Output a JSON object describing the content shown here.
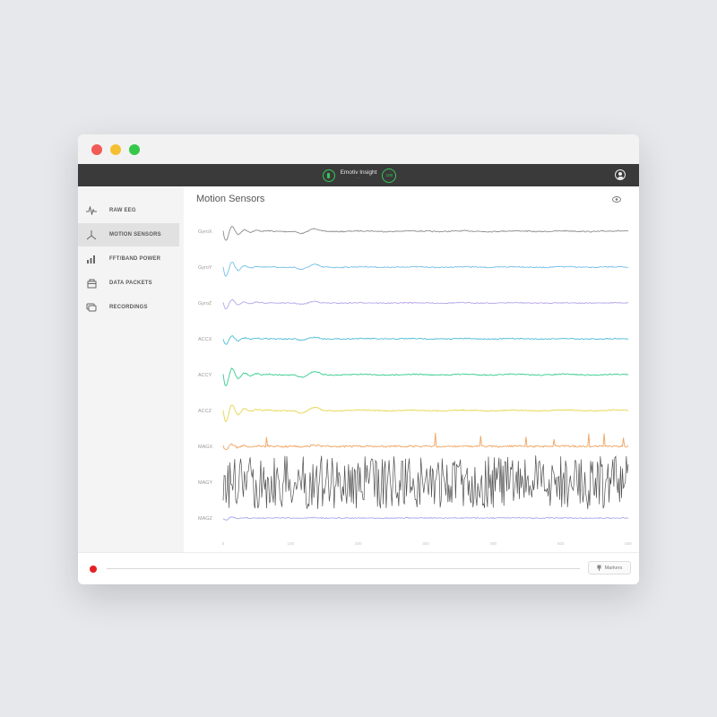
{
  "window": {
    "device": {
      "name": "Emotiv Insight",
      "subtitle": "····",
      "signal_text": "100"
    }
  },
  "sidebar": {
    "items": [
      {
        "label": "RAW EEG",
        "icon": "pulse-icon",
        "active": false
      },
      {
        "label": "MOTION SENSORS",
        "icon": "axes-icon",
        "active": true
      },
      {
        "label": "FFT/BAND POWER",
        "icon": "bars-icon",
        "active": false
      },
      {
        "label": "DATA PACKETS",
        "icon": "package-icon",
        "active": false
      },
      {
        "label": "RECORDINGS",
        "icon": "recordings-icon",
        "active": false
      }
    ]
  },
  "main": {
    "title": "Motion Sensors"
  },
  "footer": {
    "markers_label": "Markers"
  },
  "colors": {
    "accent_green": "#32c85a",
    "record_red": "#e52222",
    "channel_colors": [
      "#8c8c8c",
      "#74bfe6",
      "#b6a5e8",
      "#4dbcd4",
      "#35cc8c",
      "#e6d54a",
      "#f0a35e",
      "#505050",
      "#a8a8ee"
    ]
  },
  "chart_data": {
    "type": "line",
    "title": "",
    "series": [
      {
        "name": "GyroX",
        "amplitude": 0.25,
        "noise": "low"
      },
      {
        "name": "GyroY",
        "amplitude": 0.25,
        "noise": "low"
      },
      {
        "name": "GyroZ",
        "amplitude": 0.15,
        "noise": "low"
      },
      {
        "name": "ACCX",
        "amplitude": 0.15,
        "noise": "low"
      },
      {
        "name": "ACCY",
        "amplitude": 0.3,
        "noise": "low"
      },
      {
        "name": "ACCZ",
        "amplitude": 0.3,
        "noise": "low"
      },
      {
        "name": "MAGX",
        "amplitude": 0.1,
        "noise": "spiky"
      },
      {
        "name": "MAGY",
        "amplitude": 1.0,
        "noise": "high"
      },
      {
        "name": "MAGZ",
        "amplitude": 0.05,
        "noise": "low"
      }
    ],
    "x_ticks": [
      "0",
      "100",
      "200",
      "300",
      "400",
      "500",
      "600"
    ],
    "grid": false,
    "legend": "left"
  }
}
